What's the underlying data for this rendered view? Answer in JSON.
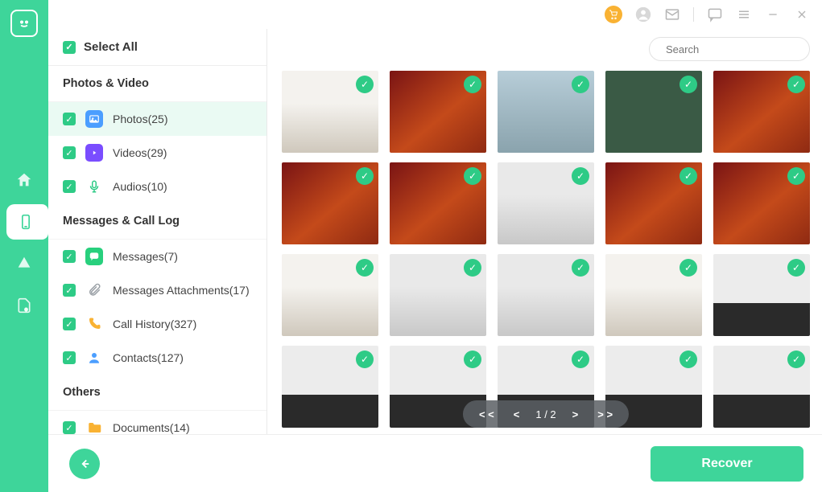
{
  "select_all_label": "Select All",
  "search": {
    "placeholder": "Search"
  },
  "groups": [
    {
      "title": "Photos & Video",
      "items": [
        {
          "key": "photos",
          "label": "Photos(25)",
          "icon": "photo-icon",
          "active": true
        },
        {
          "key": "videos",
          "label": "Videos(29)",
          "icon": "video-icon"
        },
        {
          "key": "audios",
          "label": "Audios(10)",
          "icon": "audio-icon"
        }
      ]
    },
    {
      "title": "Messages & Call Log",
      "items": [
        {
          "key": "messages",
          "label": "Messages(7)",
          "icon": "message-icon"
        },
        {
          "key": "attachments",
          "label": "Messages Attachments(17)",
          "icon": "attachment-icon"
        },
        {
          "key": "callhistory",
          "label": "Call History(327)",
          "icon": "call-icon"
        },
        {
          "key": "contacts",
          "label": "Contacts(127)",
          "icon": "contact-icon"
        }
      ]
    },
    {
      "title": "Others",
      "items": [
        {
          "key": "documents",
          "label": "Documents(14)",
          "icon": "document-icon"
        }
      ]
    }
  ],
  "pager": {
    "first": "< <",
    "prev": "<",
    "label": "1 / 2",
    "next": ">",
    "last": "> >"
  },
  "footer": {
    "recover_label": "Recover"
  },
  "thumbs": [
    "office",
    "snack",
    "phone",
    "train",
    "snack",
    "snack",
    "snack",
    "monitor",
    "snack",
    "snack",
    "office",
    "monitor",
    "monitor",
    "office",
    "keyboard",
    "keyboard",
    "keyboard",
    "keyboard",
    "keyboard",
    "keyboard"
  ]
}
